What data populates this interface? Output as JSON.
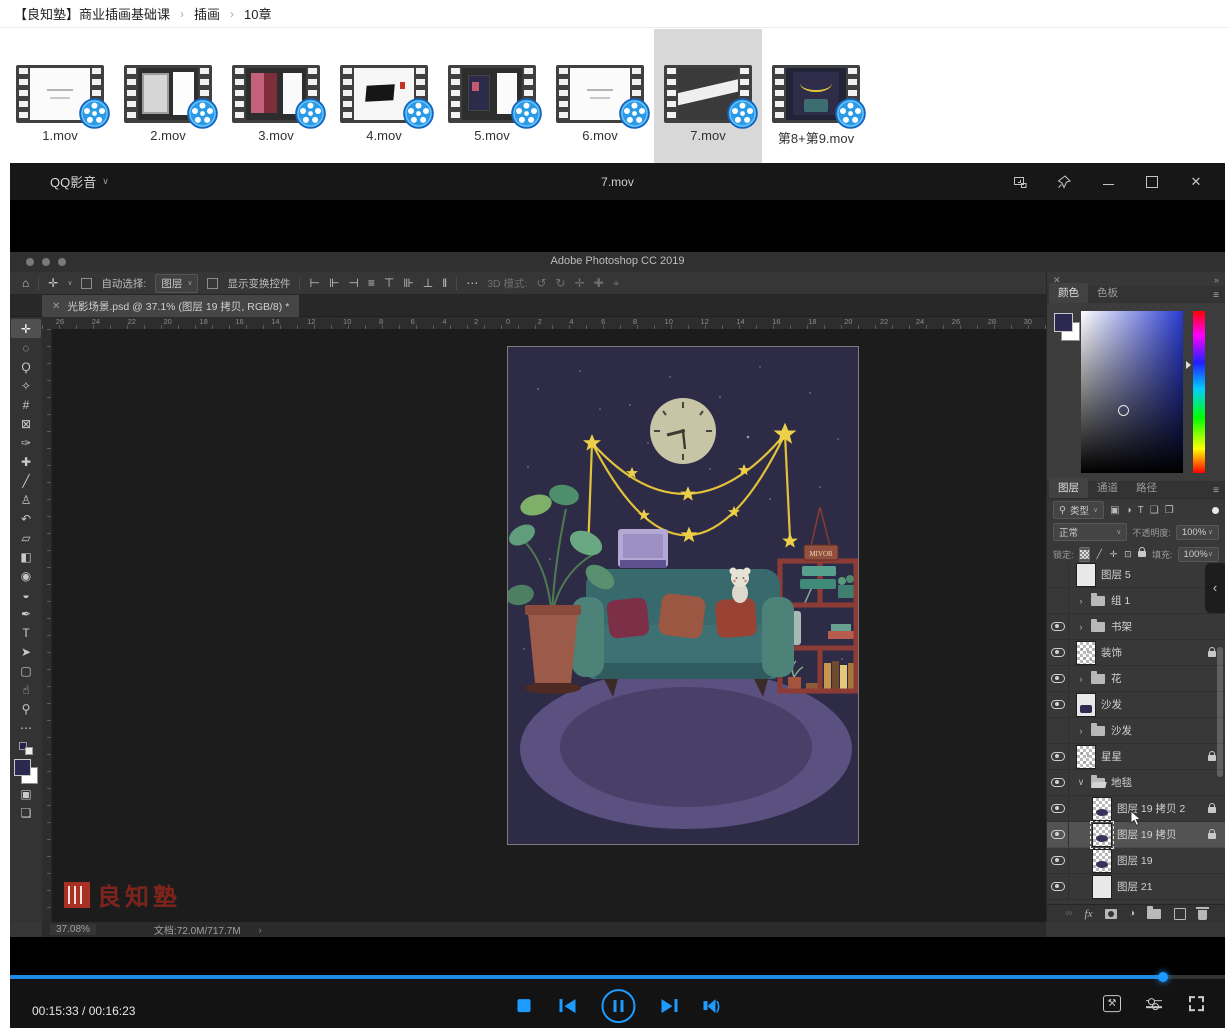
{
  "breadcrumb": {
    "separator": "›",
    "items": [
      "【良知塾】商业插画基础课",
      "插画",
      "10章"
    ]
  },
  "file_browser": {
    "selected_index": 6,
    "items": [
      {
        "label": "1.mov",
        "preview": "slide-light"
      },
      {
        "label": "2.mov",
        "preview": "ui-dark-2panel"
      },
      {
        "label": "3.mov",
        "preview": "ui-dark-posters"
      },
      {
        "label": "4.mov",
        "preview": "calligraphy"
      },
      {
        "label": "5.mov",
        "preview": "ui-dark-art"
      },
      {
        "label": "6.mov",
        "preview": "slide-light"
      },
      {
        "label": "7.mov",
        "preview": "slide-diagonal"
      },
      {
        "label": "第8+第9.mov",
        "preview": "night-art"
      }
    ]
  },
  "player": {
    "app_name": "QQ影音",
    "window_title": "7.mov",
    "time_display": "00:15:33 / 00:16:23",
    "progress_percent": 94.9,
    "accent_color": "#1e9bff"
  },
  "photoshop": {
    "window_title": "Adobe Photoshop CC 2019",
    "document_tab": "光影场景.psd @ 37.1% (图层 19 拷贝, RGB/8) *",
    "options_bar": {
      "auto_select_label": "自动选择:",
      "auto_select_value": "图层",
      "show_transform_label": "显示变换控件",
      "mode_3d_label": "3D 模式:"
    },
    "ruler_numbers": [
      "26",
      "24",
      "22",
      "20",
      "18",
      "16",
      "14",
      "12",
      "10",
      "8",
      "6",
      "4",
      "2",
      "0",
      "2",
      "4",
      "6",
      "8",
      "10",
      "12",
      "14",
      "16",
      "18",
      "20",
      "22",
      "24",
      "26",
      "28",
      "30"
    ],
    "tools": [
      {
        "name": "move-tool",
        "glyph": "✛",
        "selected": true
      },
      {
        "name": "marquee-tool",
        "glyph": "◌"
      },
      {
        "name": "lasso-tool",
        "glyph": "Ϙ"
      },
      {
        "name": "wand-tool",
        "glyph": "✧"
      },
      {
        "name": "crop-tool",
        "glyph": "#"
      },
      {
        "name": "frame-tool",
        "glyph": "⊠"
      },
      {
        "name": "eyedropper-tool",
        "glyph": "✑"
      },
      {
        "name": "heal-tool",
        "glyph": "✚"
      },
      {
        "name": "brush-tool",
        "glyph": "╱"
      },
      {
        "name": "stamp-tool",
        "glyph": "♙"
      },
      {
        "name": "history-brush-tool",
        "glyph": "↶"
      },
      {
        "name": "eraser-tool",
        "glyph": "▱"
      },
      {
        "name": "gradient-tool",
        "glyph": "◧"
      },
      {
        "name": "blur-tool",
        "glyph": "◉"
      },
      {
        "name": "dodge-tool",
        "glyph": "◒"
      },
      {
        "name": "pen-tool",
        "glyph": "✒"
      },
      {
        "name": "type-tool",
        "glyph": "T"
      },
      {
        "name": "path-select-tool",
        "glyph": "➤"
      },
      {
        "name": "shape-tool",
        "glyph": "▢"
      },
      {
        "name": "hand-tool",
        "glyph": "☝"
      },
      {
        "name": "zoom-tool",
        "glyph": "⚲"
      },
      {
        "name": "more-tools",
        "glyph": "⋯"
      }
    ],
    "color_panel": {
      "tabs": [
        "颜色",
        "色板"
      ],
      "foreground_color": "#2c2950",
      "background_color": "#ffffff"
    },
    "layers_panel": {
      "tabs": [
        "图层",
        "通道",
        "路径"
      ],
      "filter_label": "类型",
      "blend_mode": "正常",
      "opacity_label": "不透明度:",
      "opacity_value": "100%",
      "lock_label": "锁定:",
      "fill_label": "填充:",
      "fill_value": "100%",
      "fx_label": "fx",
      "layers": [
        {
          "name": "图层 5",
          "kind": "layer",
          "eye": false,
          "lock": false,
          "indent": 0,
          "thumb": "light"
        },
        {
          "name": "组 1",
          "kind": "group",
          "eye": false,
          "lock": false,
          "indent": 0
        },
        {
          "name": "书架",
          "kind": "group",
          "eye": true,
          "lock": false,
          "indent": 0
        },
        {
          "name": "装饰",
          "kind": "layer",
          "eye": true,
          "lock": true,
          "indent": 0,
          "thumb": "decor"
        },
        {
          "name": "花",
          "kind": "group",
          "eye": true,
          "lock": false,
          "indent": 0
        },
        {
          "name": "沙发",
          "kind": "layer",
          "eye": true,
          "lock": false,
          "indent": 0,
          "thumb": "sofa"
        },
        {
          "name": "沙发",
          "kind": "group",
          "eye": false,
          "lock": false,
          "indent": 0
        },
        {
          "name": "星星",
          "kind": "layer",
          "eye": true,
          "lock": true,
          "indent": 0,
          "thumb": "stars"
        },
        {
          "name": "地毯",
          "kind": "group-open",
          "eye": true,
          "lock": false,
          "indent": 0
        },
        {
          "name": "图层 19 拷贝 2",
          "kind": "layer",
          "eye": true,
          "lock": true,
          "indent": 1,
          "thumb": "rug"
        },
        {
          "name": "图层 19 拷贝",
          "kind": "layer",
          "eye": true,
          "lock": true,
          "indent": 1,
          "thumb": "rug",
          "selected": true
        },
        {
          "name": "图层 19",
          "kind": "layer",
          "eye": true,
          "lock": false,
          "indent": 1,
          "thumb": "rug"
        },
        {
          "name": "图层 21",
          "kind": "layer",
          "eye": true,
          "lock": false,
          "indent": 1,
          "thumb": "light"
        }
      ]
    },
    "status_bar": {
      "zoom_level": "37.08%",
      "document_size": "文档:72.0M/717.7M"
    },
    "watermark_text": "良知塾"
  },
  "artwork": {
    "sign_text": "MIVOR"
  },
  "colors": {
    "selection_bg": "#d8d8d8",
    "seal_red": "#a93124",
    "progress_blue": "#1e8ae6"
  }
}
